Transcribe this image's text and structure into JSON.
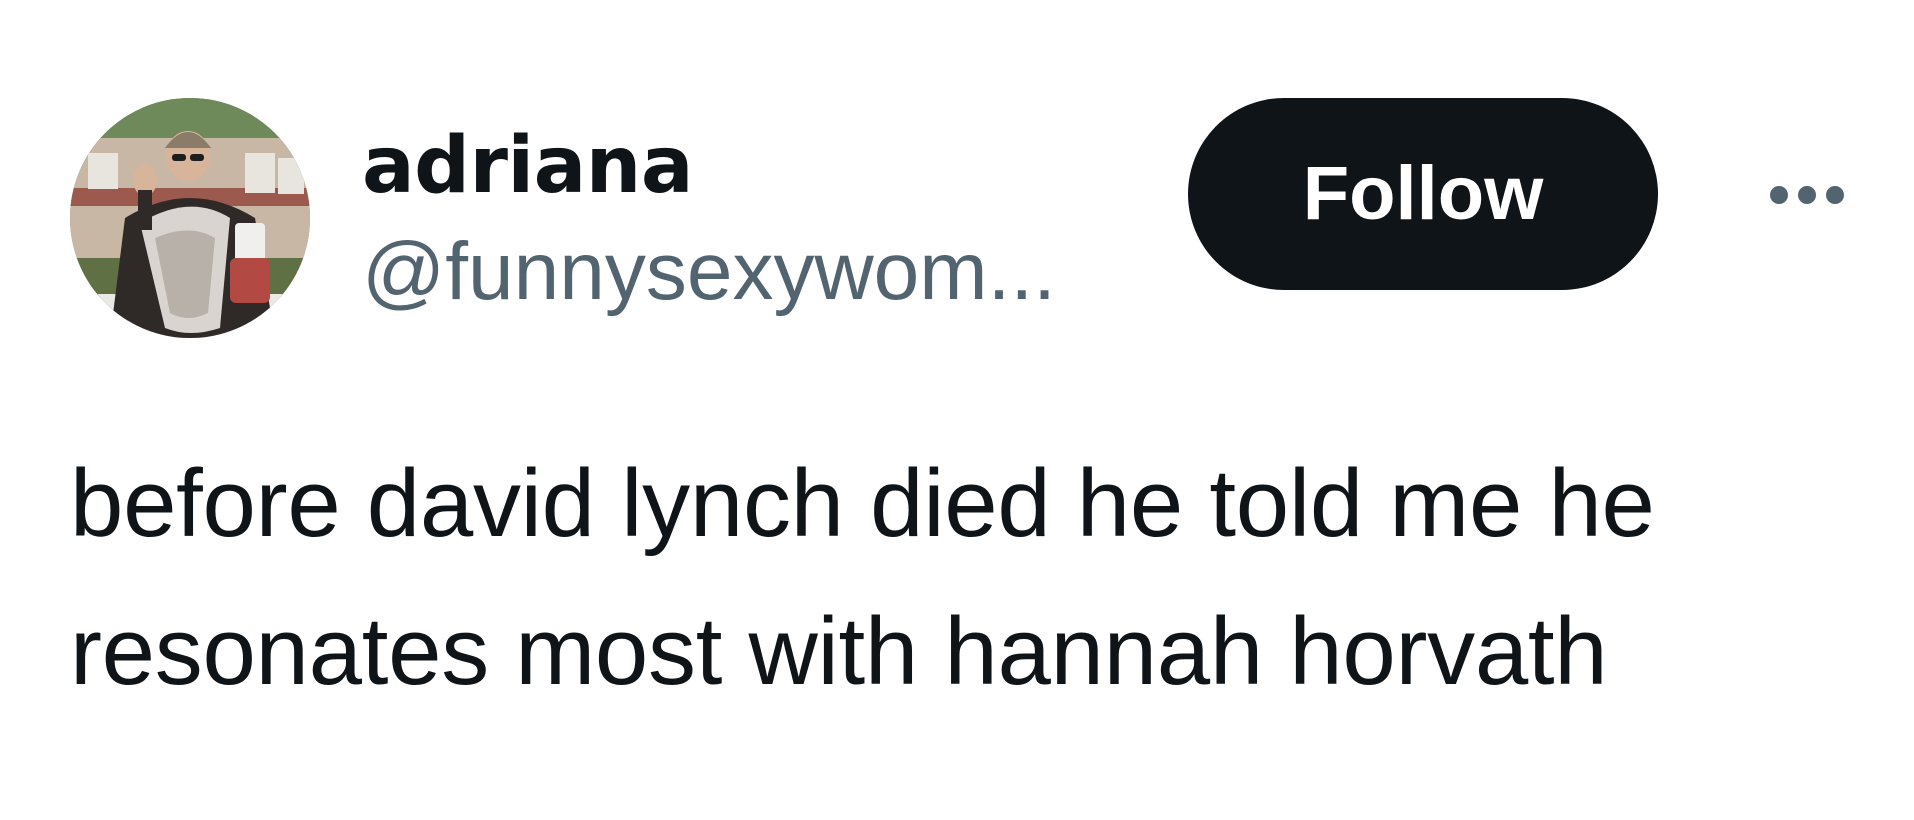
{
  "author": {
    "display_name": "adriana",
    "handle": "@funnysexywom...",
    "avatar_icon": "profile-photo"
  },
  "actions": {
    "follow_label": "Follow",
    "more_icon": "more-horizontal-icon"
  },
  "tweet": {
    "lines": [
      "before david lynch died he told me he",
      "resonates most with hannah horvath"
    ]
  },
  "colors": {
    "text_primary": "#0f1419",
    "text_secondary": "#536471",
    "follow_bg": "#0f1419",
    "follow_text": "#ffffff",
    "background": "#ffffff"
  }
}
